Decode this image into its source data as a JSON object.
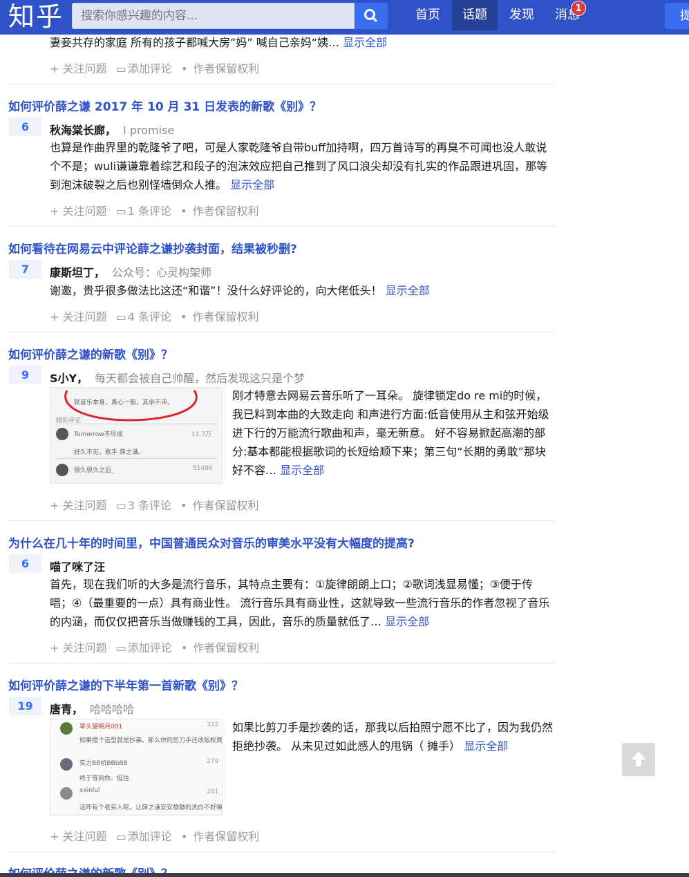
{
  "header": {
    "logo": "知乎",
    "search_placeholder": "搜索你感兴趣的内容...",
    "nav": [
      "首页",
      "话题",
      "发现",
      "消息"
    ],
    "active_nav": "话题",
    "notification_count": "1",
    "ask_label": "提问",
    "brand_color": "#2f52c8"
  },
  "prev_item": {
    "excerpt": "妻妾共存的家庭 所有的孩子都喊大房“妈” 喊自己亲妈“姨…",
    "show_all": "显示全部",
    "follow": "关注问题",
    "comment": "添加评论",
    "rights": "作者保留权利"
  },
  "items": [
    {
      "title": "如何评价薛之谦 2017 年 10 月 31 日发表的新歌《别》？",
      "votes": "6",
      "author": "秋海棠长廊",
      "bio": "I promise",
      "excerpt": "也算是作曲界里的乾隆爷了吧，可是人家乾隆爷自带buff加持啊，四万首诗写的再臭不可闻也没人敢说个不是；wuli谦谦靠着综艺和段子的泡沫效应把自己推到了风口浪尖却没有扎实的作品跟进巩固，那等到泡沫破裂之后也别怪墙倒众人推。",
      "show_all": "显示全部",
      "follow": "关注问题",
      "comment": "1 条评论",
      "rights": "作者保留权利"
    },
    {
      "title": "如何看待在网易云中评论薛之谦抄袭封面，结果被秒删?",
      "votes": "7",
      "author": "康斯坦丁",
      "bio": "公众号：心灵构架师",
      "excerpt": "谢邀，贵乎很多做法比这还“和谐”！没什么好评论的，向大佬低头！",
      "show_all": "显示全部",
      "follow": "关注问题",
      "comment": "4 条评论",
      "rights": "作者保留权利"
    },
    {
      "title": "如何评价薛之谦的新歌《别》？",
      "votes": "9",
      "author": "S小Y",
      "bio": "每天都会被自己帅醒，然后发现这只是个梦",
      "excerpt": "刚才特意去网易云音乐听了一耳朵。 旋律锁定do re mi的时候，我已料到本曲的大致走向 和声进行方面:低音使用从主和弦开始级进下行的万能流行歌曲和声，毫无新意。 好不容易掀起高潮的部分:基本都能根据歌词的长短给顺下来；第三句“长期的勇敢”那块好不容…",
      "show_all": "显示全部",
      "follow": "关注问题",
      "comment": "3 条评论",
      "rights": "作者保留权利",
      "thumb_lines": [
        "就音乐本身，真心一般，其余不评。",
        "精彩评论",
        "Tomorrow不尽成",
        "11.7万",
        "好久不见，歌手 薛之谦。",
        "很久很久之后_",
        "51496"
      ]
    },
    {
      "title": "为什么在几十年的时间里，中国普通民众对音乐的审美水平没有大幅度的提高?",
      "votes": "6",
      "author": "喵了咪了汪",
      "bio": "",
      "excerpt": "首先，现在我们听的大多是流行音乐，其特点主要有：①旋律朗朗上口；②歌词浅显易懂；③便于传唱；④（最重要的一点）具有商业性。 流行音乐具有商业性，这就导致一些流行音乐的作者忽视了音乐的内涵，而仅仅把音乐当做赚钱的工具，因此，音乐的质量就低了…",
      "show_all": "显示全部",
      "follow": "关注问题",
      "comment": "添加评论",
      "rights": "作者保留权利"
    },
    {
      "title": "如何评价薛之谦的下半年第一首新歌《别》？",
      "votes": "19",
      "author": "唐青",
      "bio": "哈哈哈哈",
      "excerpt": "如果比剪刀手是抄袭的话，那我以后拍照宁愿不比了，因为我仍然拒绝抄袭。 从未见过如此感人的甩锅（ 摊手）",
      "show_all": "显示全部",
      "follow": "关注问题",
      "comment": "添加评论",
      "rights": "作者保留权利",
      "thumb_lines": [
        "草头望明月001",
        "322",
        "如果摆个造型就是抄袭。那么你的剪刀手还收版权费不",
        "实力BB机BBbBB",
        "279",
        "终于等到你。挺住",
        "xxinlul",
        "281",
        "这昨有个老实人呢。让薛之谦安安静静的洗白不好嘛"
      ]
    }
  ],
  "next_title": "如何评价薛之谦的新歌《别》？"
}
